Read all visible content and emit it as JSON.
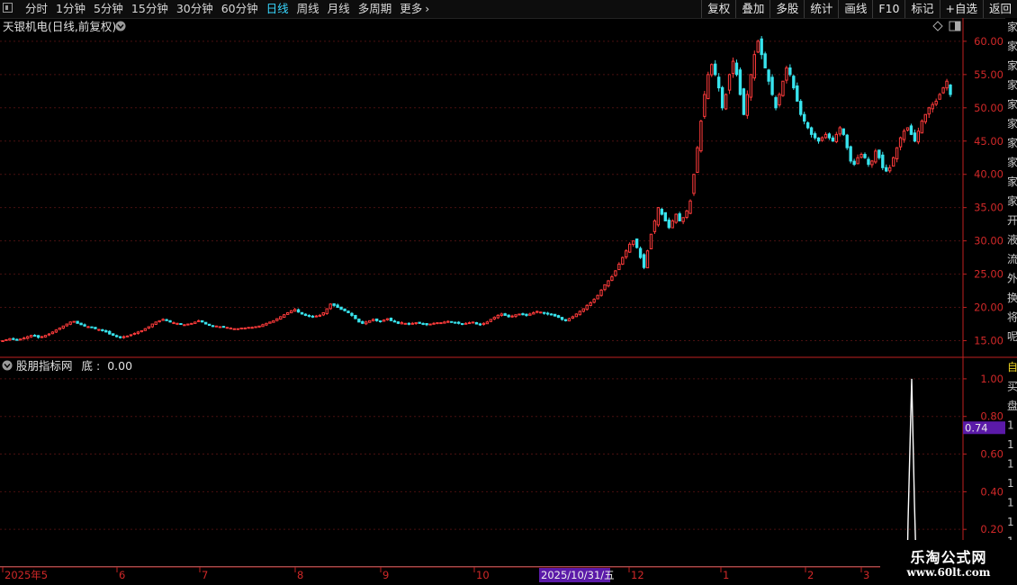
{
  "toolbar": {
    "periods": [
      {
        "label": "分时",
        "active": false
      },
      {
        "label": "1分钟",
        "active": false
      },
      {
        "label": "5分钟",
        "active": false
      },
      {
        "label": "15分钟",
        "active": false
      },
      {
        "label": "30分钟",
        "active": false
      },
      {
        "label": "60分钟",
        "active": false
      },
      {
        "label": "日线",
        "active": true
      },
      {
        "label": "周线",
        "active": false
      },
      {
        "label": "月线",
        "active": false
      },
      {
        "label": "多周期",
        "active": false
      },
      {
        "label": "更多",
        "active": false
      }
    ],
    "actions": [
      "复权",
      "叠加",
      "多股",
      "统计",
      "画线",
      "F10",
      "标记",
      "+自选",
      "返回"
    ]
  },
  "main_chart": {
    "title": "天银机电(日线,前复权)",
    "price_axis": {
      "ticks": [
        "60.00",
        "55.00",
        "50.00",
        "45.00",
        "40.00",
        "35.00",
        "30.00",
        "25.00",
        "20.00",
        "15.00"
      ],
      "min": 12.5,
      "max": 63.5
    },
    "side_strip_glyphs": [
      "家",
      "家",
      "家",
      "家",
      "家",
      "家",
      "家",
      "家",
      "家",
      "家",
      "开",
      "液",
      "流",
      "外",
      "换",
      "将",
      "呢"
    ]
  },
  "indicator": {
    "title": "股朋指标网",
    "label": "底",
    "value": "0.00",
    "axis_ticks": [
      "1.00",
      "0.80",
      "0.60",
      "0.40",
      "0.20"
    ],
    "current_value": "0.74",
    "side_strip_glyphs": [
      "自",
      "买",
      "盘",
      "1",
      "1",
      "1",
      "1",
      "1",
      "1",
      "1"
    ]
  },
  "time_axis": {
    "labels": [
      "2025年5",
      "6",
      "7",
      "8",
      "9",
      "10",
      "12",
      "1",
      "2",
      "3"
    ],
    "cursor_date": "2025/10/31/五"
  },
  "watermark": {
    "line1": "乐淘公式网",
    "line2": "www.60lt.com"
  },
  "colors": {
    "up": "#ff3b3b",
    "down": "#38e4ee",
    "axis": "#c02020",
    "active": "#38d7ff",
    "badge": "#5b1aa8"
  },
  "chart_data": {
    "type": "candlestick",
    "close_prices": [
      15.0,
      15.15,
      15.3,
      15.2,
      15.1,
      15.25,
      15.4,
      15.6,
      15.8,
      15.7,
      15.5,
      15.6,
      15.8,
      16.0,
      16.3,
      16.6,
      16.9,
      17.2,
      17.5,
      17.8,
      17.9,
      17.6,
      17.4,
      17.2,
      17.1,
      17.0,
      16.8,
      16.7,
      16.5,
      16.3,
      16.0,
      15.8,
      15.6,
      15.5,
      15.6,
      15.7,
      15.9,
      16.1,
      16.3,
      16.5,
      16.8,
      17.1,
      17.5,
      17.8,
      18.0,
      18.2,
      18.0,
      17.8,
      17.7,
      17.6,
      17.5,
      17.4,
      17.5,
      17.6,
      17.8,
      18.0,
      17.8,
      17.5,
      17.3,
      17.2,
      17.2,
      17.1,
      17.0,
      17.0,
      16.9,
      16.8,
      16.8,
      16.9,
      16.9,
      17.0,
      17.0,
      17.1,
      17.2,
      17.4,
      17.6,
      17.8,
      18.0,
      18.3,
      18.6,
      18.9,
      19.2,
      19.5,
      19.7,
      19.3,
      19.0,
      18.8,
      18.7,
      18.6,
      18.7,
      18.8,
      19.2,
      19.8,
      20.5,
      20.3,
      20.0,
      19.7,
      19.5,
      19.2,
      18.8,
      18.3,
      17.8,
      17.6,
      17.8,
      18.0,
      18.2,
      18.0,
      17.9,
      18.1,
      18.3,
      18.0,
      17.8,
      17.6,
      17.7,
      17.6,
      17.5,
      17.6,
      17.7,
      17.6,
      17.5,
      17.4,
      17.5,
      17.6,
      17.7,
      17.7,
      17.8,
      17.9,
      17.8,
      17.7,
      17.6,
      17.5,
      17.6,
      17.7,
      17.8,
      17.5,
      17.4,
      17.6,
      17.8,
      18.2,
      18.5,
      18.8,
      19.0,
      18.8,
      18.6,
      18.7,
      18.9,
      19.0,
      18.9,
      18.8,
      19.0,
      19.2,
      19.4,
      19.3,
      19.1,
      19.0,
      18.9,
      18.7,
      18.5,
      18.2,
      18.0,
      18.3,
      18.6,
      19.0,
      19.4,
      19.8,
      20.3,
      20.7,
      21.2,
      21.8,
      22.6,
      23.4,
      24.0,
      24.6,
      25.5,
      26.5,
      27.5,
      28.5,
      29.5,
      30.0,
      29.0,
      27.5,
      26.0,
      28.5,
      31.0,
      33.0,
      35.0,
      34.0,
      33.0,
      32.0,
      33.0,
      34.0,
      33.0,
      33.5,
      34.5,
      36.0,
      40.0,
      44.0,
      48.0,
      52.0,
      55.0,
      56.5,
      55.0,
      53.0,
      50.0,
      52.0,
      55.0,
      57.0,
      55.0,
      52.0,
      49.0,
      52.0,
      55.0,
      58.0,
      60.0,
      58.0,
      56.0,
      54.0,
      52.0,
      50.0,
      52.0,
      54.0,
      56.0,
      55.0,
      53.0,
      51.0,
      49.0,
      48.0,
      47.0,
      46.0,
      45.5,
      45.0,
      45.5,
      46.0,
      45.5,
      45.0,
      46.0,
      47.0,
      46.0,
      44.0,
      42.0,
      41.5,
      42.5,
      43.0,
      42.5,
      41.5,
      42.0,
      43.5,
      42.5,
      41.0,
      40.5,
      41.0,
      42.5,
      44.0,
      45.5,
      46.5,
      47.0,
      46.0,
      45.0,
      46.5,
      48.0,
      49.0,
      50.0,
      50.5,
      51.0,
      52.0,
      53.0,
      54.0,
      52.0
    ],
    "indicator": {
      "name": "底",
      "current": 0.0,
      "cursor_value": 0.74,
      "peak": 1.0,
      "peak_position": "near right edge",
      "axis_range": [
        0,
        1.0
      ]
    }
  }
}
